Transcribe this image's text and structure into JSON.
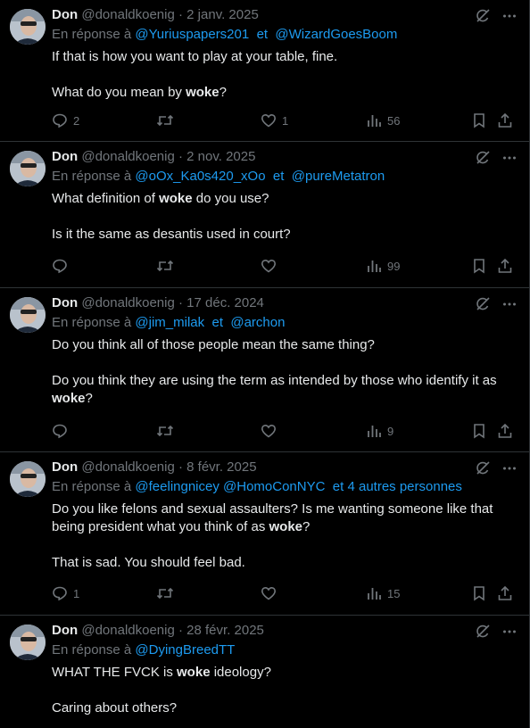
{
  "tweets": [
    {
      "name": "Don",
      "handle": "@donaldkoenig",
      "date": "· 2 janv. 2025",
      "reply_prefix": "En réponse à",
      "reply_to": [
        "@Yuriuspapers201",
        "et",
        "@WizardGoesBoom"
      ],
      "paragraphs": [
        [
          "If that is how you want to play at your table, fine.",
          ""
        ],
        [
          "What do you mean by ",
          "woke",
          "?"
        ]
      ],
      "counts": {
        "reply": "2",
        "retweet": "",
        "like": "1",
        "views": "56"
      }
    },
    {
      "name": "Don",
      "handle": "@donaldkoenig",
      "date": "· 2 nov. 2025",
      "reply_prefix": "En réponse à",
      "reply_to": [
        "@oOx_Ka0s420_xOo",
        "et",
        "@pureMetatron"
      ],
      "paragraphs": [
        [
          "What definition of ",
          "woke",
          " do you use?"
        ],
        [
          "Is it the same as desantis used in court?",
          ""
        ]
      ],
      "counts": {
        "reply": "",
        "retweet": "",
        "like": "",
        "views": "99"
      }
    },
    {
      "name": "Don",
      "handle": "@donaldkoenig",
      "date": "· 17 déc. 2024",
      "reply_prefix": "En réponse à",
      "reply_to": [
        "@jim_milak",
        "et",
        "@archon"
      ],
      "paragraphs": [
        [
          "Do you think all of those people mean the same thing?",
          ""
        ],
        [
          "Do you think they are using the term as intended by those who identify it as ",
          "woke",
          "?"
        ]
      ],
      "counts": {
        "reply": "",
        "retweet": "",
        "like": "",
        "views": "9"
      }
    },
    {
      "name": "Don",
      "handle": "@donaldkoenig",
      "date": "· 8 févr. 2025",
      "reply_prefix": "En réponse à",
      "reply_to": [
        "@feelingnicey @HomoConNYC",
        "et 4 autres personnes",
        ""
      ],
      "paragraphs": [
        [
          "Do you like felons and sexual assaulters? Is me wanting someone like that being president what you think of as ",
          "woke",
          "?"
        ],
        [
          "That is sad. You should feel bad.",
          ""
        ]
      ],
      "counts": {
        "reply": "1",
        "retweet": "",
        "like": "",
        "views": "15"
      }
    },
    {
      "name": "Don",
      "handle": "@donaldkoenig",
      "date": "· 28 févr. 2025",
      "reply_prefix": "En réponse à",
      "reply_to": [
        "@DyingBreedTT",
        "",
        ""
      ],
      "paragraphs": [
        [
          "WHAT THE FVCK is ",
          "woke",
          " ideology?"
        ],
        [
          "Caring about others?",
          ""
        ]
      ],
      "counts": {
        "reply": "",
        "retweet": "",
        "like": "",
        "views": ""
      }
    }
  ],
  "icons": {
    "top": [
      "grok-icon",
      "more-icon"
    ],
    "actions": [
      "reply-icon",
      "retweet-icon",
      "like-icon",
      "views-icon",
      "bookmark-icon",
      "share-icon"
    ]
  },
  "colors": {
    "background": "#000000",
    "text": "#e7e9ea",
    "muted": "#71767b",
    "link": "#1d9bf0",
    "divider": "#2f3336"
  }
}
